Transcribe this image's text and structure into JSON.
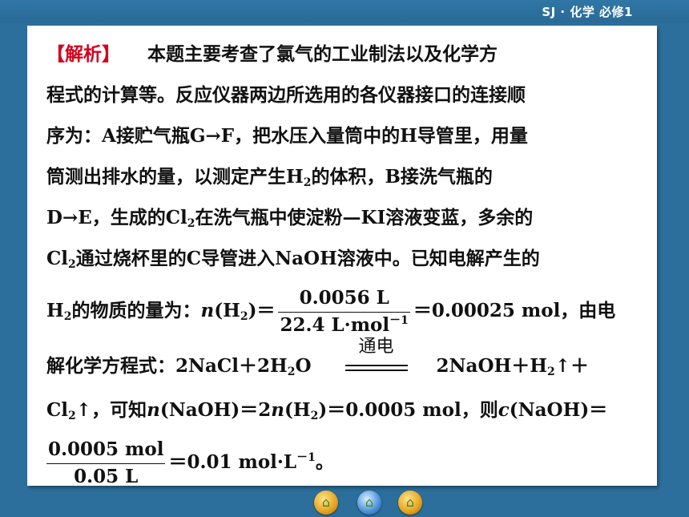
{
  "header": {
    "course_tag": "SJ · 化学  必修1"
  },
  "analysis": {
    "label": "【解析】",
    "l1": "本题主要考查了氯气的工业制法以及化学方",
    "l2": "程式的计算等。反应仪器两边所选用的各仪器接口的连接顺",
    "l3": "序为：A接贮气瓶G→F，把水压入量筒中的H导管里，用量",
    "l4a": "筒测出排水的量，以测定产生H",
    "l4b": "的体积，B接洗气瓶的",
    "l5a": "D→E，生成的Cl",
    "l5b": "在洗气瓶中使淀粉—KI溶液变蓝，多余的",
    "l6a": "Cl",
    "l6b": "通过烧杯里的C导管进入NaOH溶液中。已知电解产生的",
    "l7a": "H",
    "l7b": "的物质的量为：",
    "l7n": "n",
    "l7c": "(H",
    "l7d": ")＝",
    "frac1_num": "0.0056 L",
    "frac1_den": "22.4 L·mol",
    "frac1_den_sup": "－1",
    "l7e": "＝0.00025  mol，由电",
    "l8a": "解化学方程式：2NaCl＋2H",
    "l8b": "O",
    "cond": "通电",
    "l8c": "2NaOH＋H",
    "l8d": "↑＋",
    "l9a": "Cl",
    "l9b": "↑，可知",
    "l9n1": "n",
    "l9c": "(NaOH)＝2",
    "l9n2": "n",
    "l9d": "(H",
    "l9e": ")＝0.0005   mol，则",
    "l9c2": "c",
    "l9f": "(NaOH)＝",
    "frac2_num": "0.0005 mol",
    "frac2_den": "0.05 L",
    "l10a": "＝0.01 mol·L",
    "l10sup": "－1",
    "l10b": "。",
    "sub2": "2"
  },
  "nav": {
    "home": "home-icon",
    "menu": "menu-icon",
    "next": "next-icon"
  }
}
